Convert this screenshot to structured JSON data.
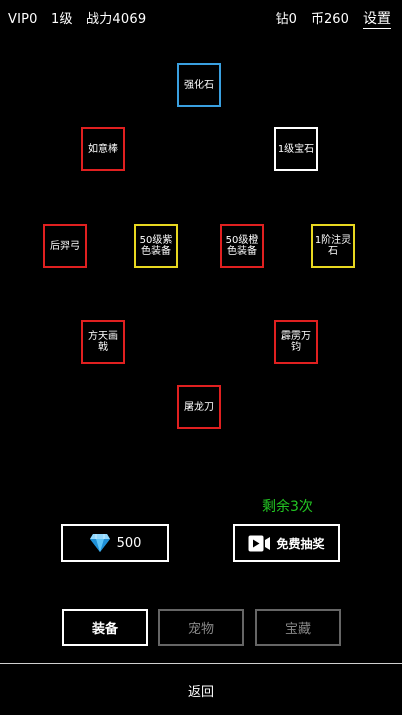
{
  "header": {
    "vip": "VIP0",
    "level": "1级",
    "power": "战力4069",
    "diamonds": "钻0",
    "coins": "币260",
    "settings_label": "设置"
  },
  "prizes": [
    {
      "label": "强化石",
      "color": "#3aa0e0"
    },
    {
      "label": "如意棒",
      "color": "#e02020"
    },
    {
      "label": "1级宝石",
      "color": "#ffffff"
    },
    {
      "label": "后羿弓",
      "color": "#e02020"
    },
    {
      "label": "50级紫色装备",
      "color": "#e8d820"
    },
    {
      "label": "50级橙色装备",
      "color": "#e02020"
    },
    {
      "label": "1阶注灵石",
      "color": "#e8d820"
    },
    {
      "label": "方天画戟",
      "color": "#e02020"
    },
    {
      "label": "霹雳万钧",
      "color": "#e02020"
    },
    {
      "label": "屠龙刀",
      "color": "#e02020"
    }
  ],
  "remaining_text": "剩余3次",
  "remaining_color": "#23c623",
  "diamond_draw": {
    "icon": "diamond-icon",
    "cost": "500"
  },
  "free_draw": {
    "icon": "video-camera-icon",
    "label": "免费抽奖"
  },
  "tabs": [
    {
      "label": "装备",
      "active": true
    },
    {
      "label": "宠物",
      "active": false
    },
    {
      "label": "宝藏",
      "active": false
    }
  ],
  "back_label": "返回"
}
